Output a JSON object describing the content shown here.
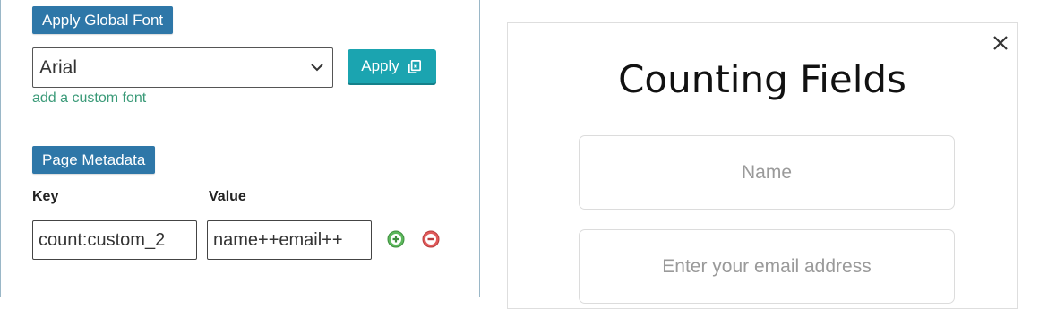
{
  "left": {
    "global_font": {
      "section_label": "Apply Global Font",
      "selected_font": "Arial",
      "apply_label": "Apply",
      "custom_font_link": "add a custom font"
    },
    "metadata": {
      "section_label": "Page Metadata",
      "key_label": "Key",
      "value_label": "Value",
      "rows": [
        {
          "key": "count:custom_2",
          "value": "name++email++"
        }
      ]
    }
  },
  "preview": {
    "title": "Counting Fields",
    "fields": [
      {
        "placeholder": "Name"
      },
      {
        "placeholder": "Enter your email address"
      }
    ]
  },
  "icons": {
    "select_arrow": "chevron-down-icon",
    "apply": "copy-icon",
    "add_row": "plus-circle-icon",
    "remove_row": "minus-circle-icon",
    "close": "close-icon"
  },
  "colors": {
    "section_label_bg": "#2e77a8",
    "apply_button_bg": "#1ba4b0",
    "link": "#3a9a78",
    "add_icon": "#5cb85c",
    "remove_icon": "#e05a5a"
  }
}
